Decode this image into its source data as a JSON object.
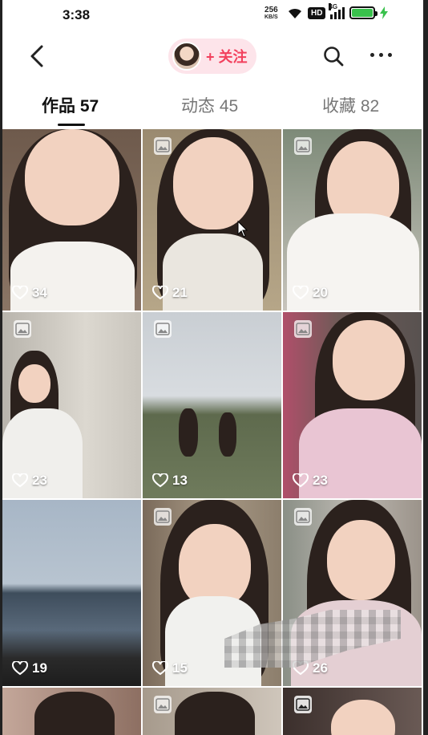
{
  "status_bar": {
    "time": "3:38",
    "net_speed_value": "256",
    "net_speed_unit": "KB/S",
    "hd": "HD",
    "signal_type": "4G",
    "battery_color": "#39c14c"
  },
  "nav": {
    "back_icon": "chevron-left-icon",
    "follow_label": "+ 关注",
    "follow_color": "#f2405d",
    "search_icon": "search-icon",
    "more_icon": "more-icon"
  },
  "tabs": [
    {
      "label": "作品 57",
      "active": true
    },
    {
      "label": "动态 45",
      "active": false
    },
    {
      "label": "收藏 82",
      "active": false
    }
  ],
  "posts": [
    {
      "likes": "34",
      "image_badge": false
    },
    {
      "likes": "21",
      "image_badge": true
    },
    {
      "likes": "20",
      "image_badge": true
    },
    {
      "likes": "23",
      "image_badge": true
    },
    {
      "likes": "13",
      "image_badge": true
    },
    {
      "likes": "23",
      "image_badge": true
    },
    {
      "likes": "19",
      "image_badge": false
    },
    {
      "likes": "15",
      "image_badge": true
    },
    {
      "likes": "26",
      "image_badge": true
    },
    {
      "likes": "",
      "image_badge": false
    },
    {
      "likes": "",
      "image_badge": true
    },
    {
      "likes": "",
      "image_badge": true
    }
  ]
}
